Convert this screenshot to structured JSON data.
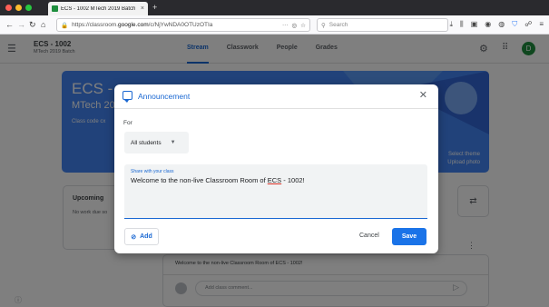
{
  "browser": {
    "tab_title": "ECS - 1002 MTech 2019 Batch",
    "tab_close": "×",
    "new_tab": "+",
    "url_prefix": "https://classroom.",
    "url_domain": "google.com",
    "url_path": "/c/NjYwNDA0OTUzOTIa",
    "url_more": "···",
    "search_placeholder": "Search",
    "icons": [
      "download-icon",
      "library-icon",
      "sidebar-icon",
      "reader-icon",
      "extension-icon",
      "shield-icon",
      "menu-icon"
    ]
  },
  "header": {
    "course_title": "ECS - 1002",
    "course_subtitle": "MTech 2019 Batch",
    "tabs": [
      {
        "label": "Stream",
        "active": true
      },
      {
        "label": "Classwork",
        "active": false
      },
      {
        "label": "People",
        "active": false
      },
      {
        "label": "Grades",
        "active": false
      }
    ],
    "avatar_letter": "D"
  },
  "banner": {
    "title": "ECS -",
    "subtitle": "MTech 20",
    "class_code": "Class code  cx",
    "select_theme": "Select theme",
    "upload_photo": "Upload photo"
  },
  "upcoming": {
    "title": "Upcoming",
    "subtitle": "No work due so"
  },
  "post": {
    "message": "Welcome to the non-live Classroom Room of ECS - 1002!",
    "comment_placeholder": "Add class comment..."
  },
  "dialog": {
    "title": "Announcement",
    "for_label": "For",
    "for_value": "All students",
    "text_label": "Share with your class",
    "text_pre": "Welcome to the non-live Classroom Room of ",
    "text_underlined": "ECS",
    "text_post": " - 1002!",
    "add_label": "Add",
    "cancel_label": "Cancel",
    "save_label": "Save"
  },
  "colors": {
    "accent": "#1a73e8",
    "banner": "#4285f4",
    "avatar": "#1e8e3e"
  }
}
